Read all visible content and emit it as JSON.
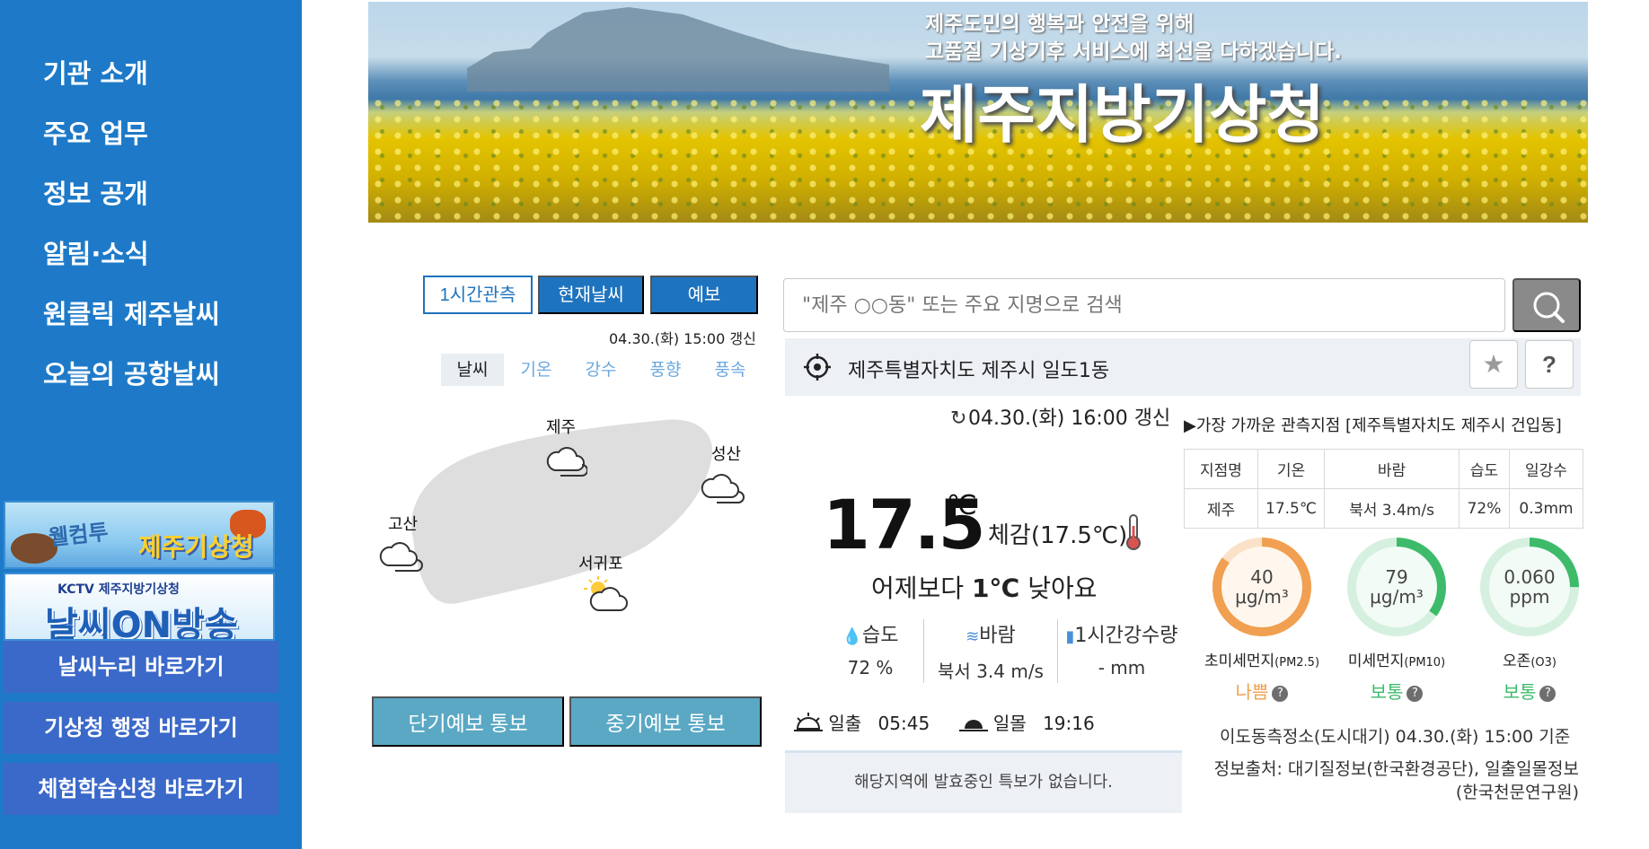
{
  "sidebar": {
    "menu": [
      "기관 소개",
      "주요 업무",
      "정보 공개",
      "알림·소식",
      "원클릭 제주날씨",
      "오늘의 공항날씨"
    ],
    "banner_welcome": {
      "line1": "웰컴투",
      "line2": "제주기상청"
    },
    "banner_kctv": {
      "top": "KCTV  제주지방기상청",
      "big": "날씨ON방송"
    },
    "quick_links": [
      "날씨누리 바로가기",
      "기상청 행정 바로가기",
      "체험학습신청 바로가기"
    ]
  },
  "hero": {
    "subtitle_line1": "제주도민의 행복과 안전을 위해",
    "subtitle_line2": "고품질 기상기후 서비스에 최선을 다하겠습니다.",
    "title": "제주지방기상청"
  },
  "weather_panel": {
    "tabs": [
      "1시간관측",
      "현재날씨",
      "예보"
    ],
    "updated": "04.30.(화) 15:00 갱신",
    "subtabs": [
      "날씨",
      "기온",
      "강수",
      "풍향",
      "풍속"
    ],
    "map_labels": {
      "jeju": "제주",
      "seongsan": "성산",
      "gosan": "고산",
      "seogwipo": "서귀포"
    },
    "forecast_buttons": [
      "단기예보 통보",
      "중기예보 통보"
    ]
  },
  "search": {
    "placeholder": "\"제주 ○○동\" 또는 주요 지명으로 검색"
  },
  "location": {
    "name": "제주특별자치도 제주시 일도1동",
    "help": "?"
  },
  "current": {
    "updated": "04.30.(화) 16:00 갱신",
    "temperature": "17.5",
    "unit": "℃",
    "feels_like": "체감(17.5℃)",
    "compare_prefix": "어제보다",
    "compare_value": "1℃",
    "compare_suffix": "낮아요",
    "humidity_label": "습도",
    "humidity_value": "72 %",
    "wind_label": "바람",
    "wind_value": "북서 3.4 m/s",
    "rain_label": "1시간강수량",
    "rain_value": "- mm",
    "sunrise_label": "일출",
    "sunrise": "05:45",
    "sunset_label": "일몰",
    "sunset": "19:16",
    "notice": "해당지역에 발효중인 특보가 없습니다."
  },
  "observation": {
    "title": "▶가장 가까운 관측지점 [제주특별자치도 제주시 건입동]",
    "headers": [
      "지점명",
      "기온",
      "바람",
      "습도",
      "일강수"
    ],
    "row": [
      "제주",
      "17.5℃",
      "북서 3.4m/s",
      "72%",
      "0.3mm"
    ]
  },
  "air_quality": {
    "items": [
      {
        "value": "40",
        "unit": "μg/m³",
        "name": "초미세먼지",
        "code": "(PM2.5)",
        "grade": "나쁨",
        "color": "#f0a050",
        "level": 0.85
      },
      {
        "value": "79",
        "unit": "μg/m³",
        "name": "미세먼지",
        "code": "(PM10)",
        "grade": "보통",
        "color": "#3dbb6a",
        "level": 0.35
      },
      {
        "value": "0.060",
        "unit": "ppm",
        "name": "오존",
        "code": "(O3)",
        "grade": "보통",
        "color": "#3dbb6a",
        "level": 0.25
      }
    ],
    "station": "이도동측정소(도시대기) 04.30.(화) 15:00 기준",
    "source_line1": "정보출처: 대기질정보(한국환경공단), 일출일몰정보",
    "source_line2": "(한국천문연구원)"
  },
  "colors": {
    "sidebar": "#1e7ac8",
    "accent": "#1e73be",
    "quick_link": "#3b69c9",
    "forecast_button": "#5aa8c4"
  }
}
